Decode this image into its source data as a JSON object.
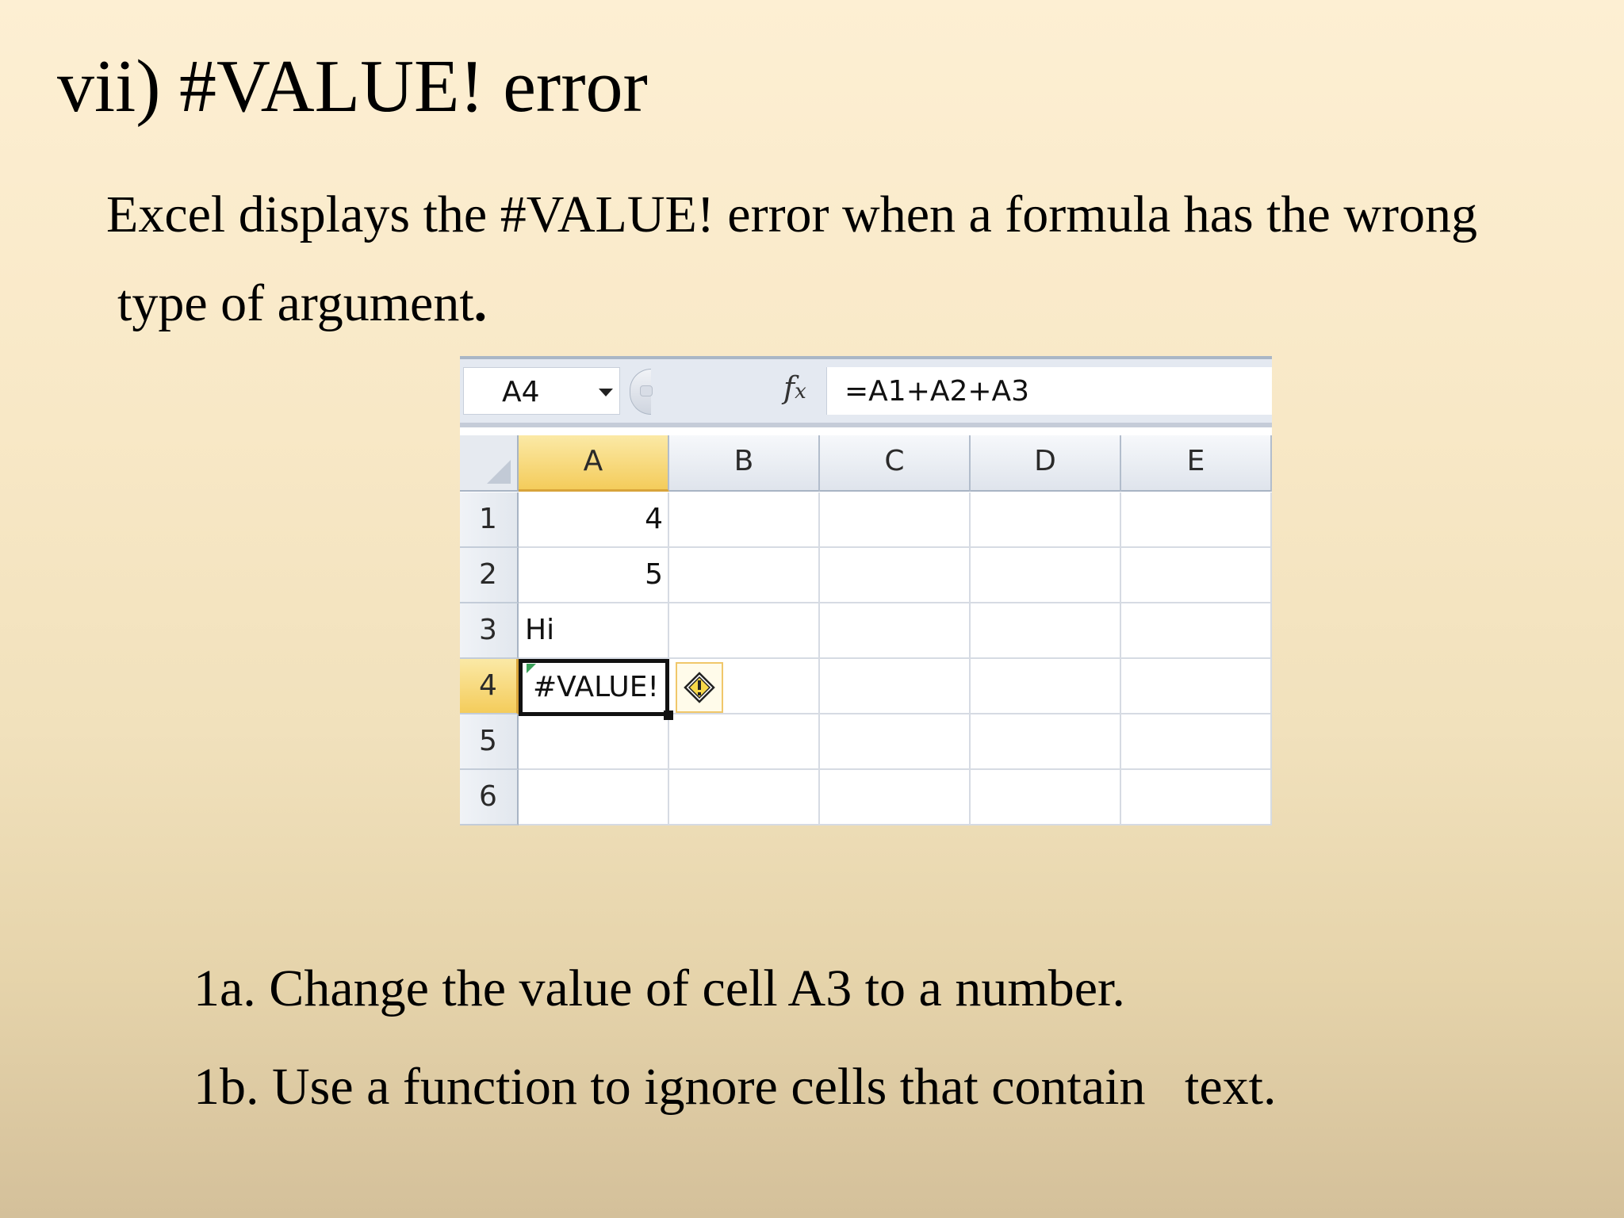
{
  "slide": {
    "title": "vii) #VALUE! error",
    "intro_line1": "Excel displays the #VALUE! error when a formula has the wrong",
    "intro_line2": "type of argument",
    "intro_period": ".",
    "steps": [
      "1a. Change the value of cell A3 to a number.",
      "1b. Use a function to ignore cells that contain   text."
    ]
  },
  "excel": {
    "name_box": "A4",
    "fx_label": "fx",
    "formula": "=A1+A2+A3",
    "columns": [
      "A",
      "B",
      "C",
      "D",
      "E"
    ],
    "rows": [
      "1",
      "2",
      "3",
      "4",
      "5",
      "6"
    ],
    "cells": {
      "A1": "4",
      "A2": "5",
      "A3": "Hi",
      "A4": "#VALUE!"
    },
    "active_cell": "A4",
    "icons": {
      "name_box_dropdown": "chevron-down-icon",
      "error_smart_tag": "warning-diamond-icon"
    },
    "colors": {
      "active_header": "#f4cc5b",
      "error_indicator": "#3aa15a"
    }
  }
}
